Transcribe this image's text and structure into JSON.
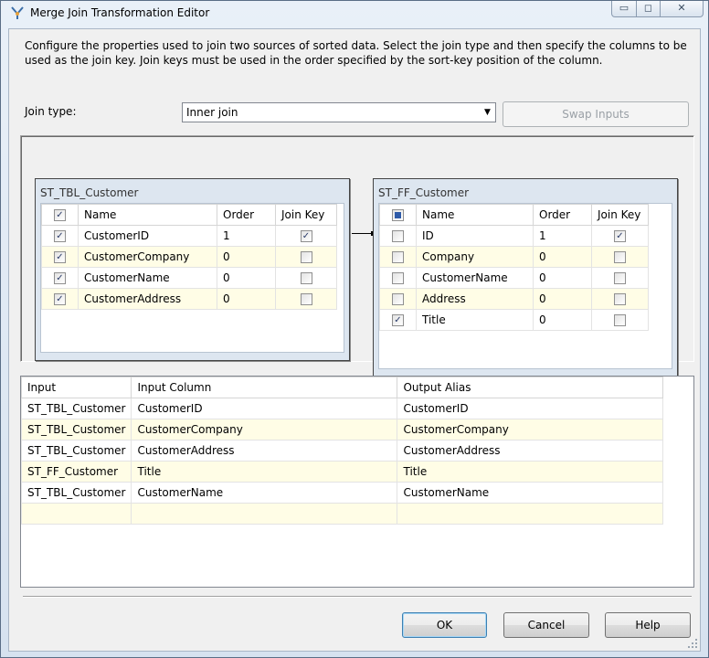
{
  "window": {
    "title": "Merge Join Transformation Editor",
    "controls": {
      "minimize": "▭",
      "maximize": "◻",
      "close": "✕"
    }
  },
  "description": "Configure the properties used to join two sources of sorted data. Select the join type and then specify the columns to be used as the join key. Join keys must be used in the order specified by the sort-key position of the column.",
  "join": {
    "label": "Join type:",
    "value": "Inner join",
    "swap_label": "Swap Inputs"
  },
  "left_input": {
    "caption": "ST_TBL_Customer",
    "headers": {
      "name": "Name",
      "order": "Order",
      "join_key": "Join Key"
    },
    "rows": [
      {
        "checked": true,
        "name": "CustomerID",
        "order": "1",
        "join_key": true
      },
      {
        "checked": true,
        "name": "CustomerCompany",
        "order": "0",
        "join_key": false
      },
      {
        "checked": true,
        "name": "CustomerName",
        "order": "0",
        "join_key": false
      },
      {
        "checked": true,
        "name": "CustomerAddress",
        "order": "0",
        "join_key": false
      }
    ]
  },
  "right_input": {
    "caption": "ST_FF_Customer",
    "headers": {
      "name": "Name",
      "order": "Order",
      "join_key": "Join Key"
    },
    "rows": [
      {
        "checked": false,
        "name": "ID",
        "order": "1",
        "join_key": true
      },
      {
        "checked": false,
        "name": "Company",
        "order": "0",
        "join_key": false
      },
      {
        "checked": false,
        "name": "CustomerName",
        "order": "0",
        "join_key": false
      },
      {
        "checked": false,
        "name": "Address",
        "order": "0",
        "join_key": false
      },
      {
        "checked": true,
        "name": "Title",
        "order": "0",
        "join_key": false
      }
    ]
  },
  "output": {
    "headers": {
      "input": "Input",
      "input_column": "Input Column",
      "output_alias": "Output Alias"
    },
    "rows": [
      {
        "input": "ST_TBL_Customer",
        "input_column": "CustomerID",
        "output_alias": "CustomerID"
      },
      {
        "input": "ST_TBL_Customer",
        "input_column": "CustomerCompany",
        "output_alias": "CustomerCompany"
      },
      {
        "input": "ST_TBL_Customer",
        "input_column": "CustomerAddress",
        "output_alias": "CustomerAddress"
      },
      {
        "input": "ST_FF_Customer",
        "input_column": "Title",
        "output_alias": "Title"
      },
      {
        "input": "ST_TBL_Customer",
        "input_column": "CustomerName",
        "output_alias": "CustomerName"
      },
      {
        "input": "",
        "input_column": "",
        "output_alias": ""
      }
    ]
  },
  "buttons": {
    "ok": "OK",
    "cancel": "Cancel",
    "help": "Help"
  },
  "colors": {
    "accent": "#3c7fb1",
    "row_alt": "#fffde6",
    "checkbox_fill": "#2e5aa8"
  }
}
